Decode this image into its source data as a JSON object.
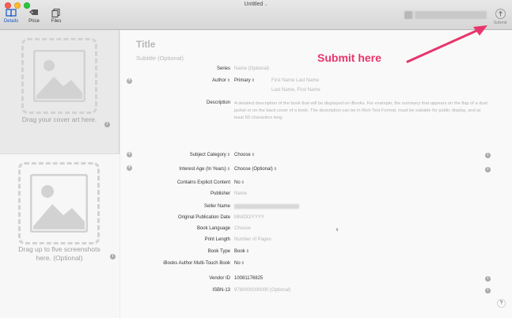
{
  "window": {
    "title": "Untitled"
  },
  "toolbar": {
    "details_label": "Details",
    "price_label": "Price",
    "files_label": "Files",
    "submit_label": "Submit"
  },
  "left": {
    "cover_text": "Drag your cover art here.",
    "shots_text": "Drag up to five screenshots here. (Optional)"
  },
  "form": {
    "title": "Title",
    "subtitle": "Subtitle (Optional)",
    "series_label": "Series",
    "series_placeholder": "Name (Optional)",
    "author_label": "Author",
    "author_role": "Primary",
    "author_first_last": "First Name Last Name",
    "author_last_first": "Last Name, First Name",
    "description_label": "Description",
    "description_placeholder": "A detailed description of the book that will be displayed on iBooks. For example, the summary that appears on the flap of a dust jacket or on the back cover of a book. The description can be in Rich Text Format, must be suitable for public display, and at least 50 characters long.",
    "subject_label": "Subject Category",
    "subject_value": "Choose",
    "interest_label": "Interest Age (In Years)",
    "interest_value": "Choose (Optional)",
    "explicit_label": "Contains Explicit Content",
    "explicit_value": "No",
    "publisher_label": "Publisher",
    "publisher_placeholder": "Name",
    "seller_label": "Seller Name",
    "pubdate_label": "Original Publication Date",
    "pubdate_placeholder": "MM/DD/YYYY",
    "language_label": "Book Language",
    "language_placeholder": "Choose",
    "printlength_label": "Print Length",
    "printlength_placeholder": "Number of Pages",
    "booktype_label": "Book Type",
    "booktype_value": "Book",
    "multitouch_label": "iBooks Author Multi-Touch Book",
    "multitouch_value": "No",
    "vendor_label": "Vendor ID",
    "vendor_value": "10081176825",
    "isbn_label": "ISBN-13",
    "isbn_placeholder": "9780000000000 (Optional)",
    "help_label": "?"
  },
  "annotation": {
    "text": "Submit here",
    "color": "#e8356b"
  }
}
